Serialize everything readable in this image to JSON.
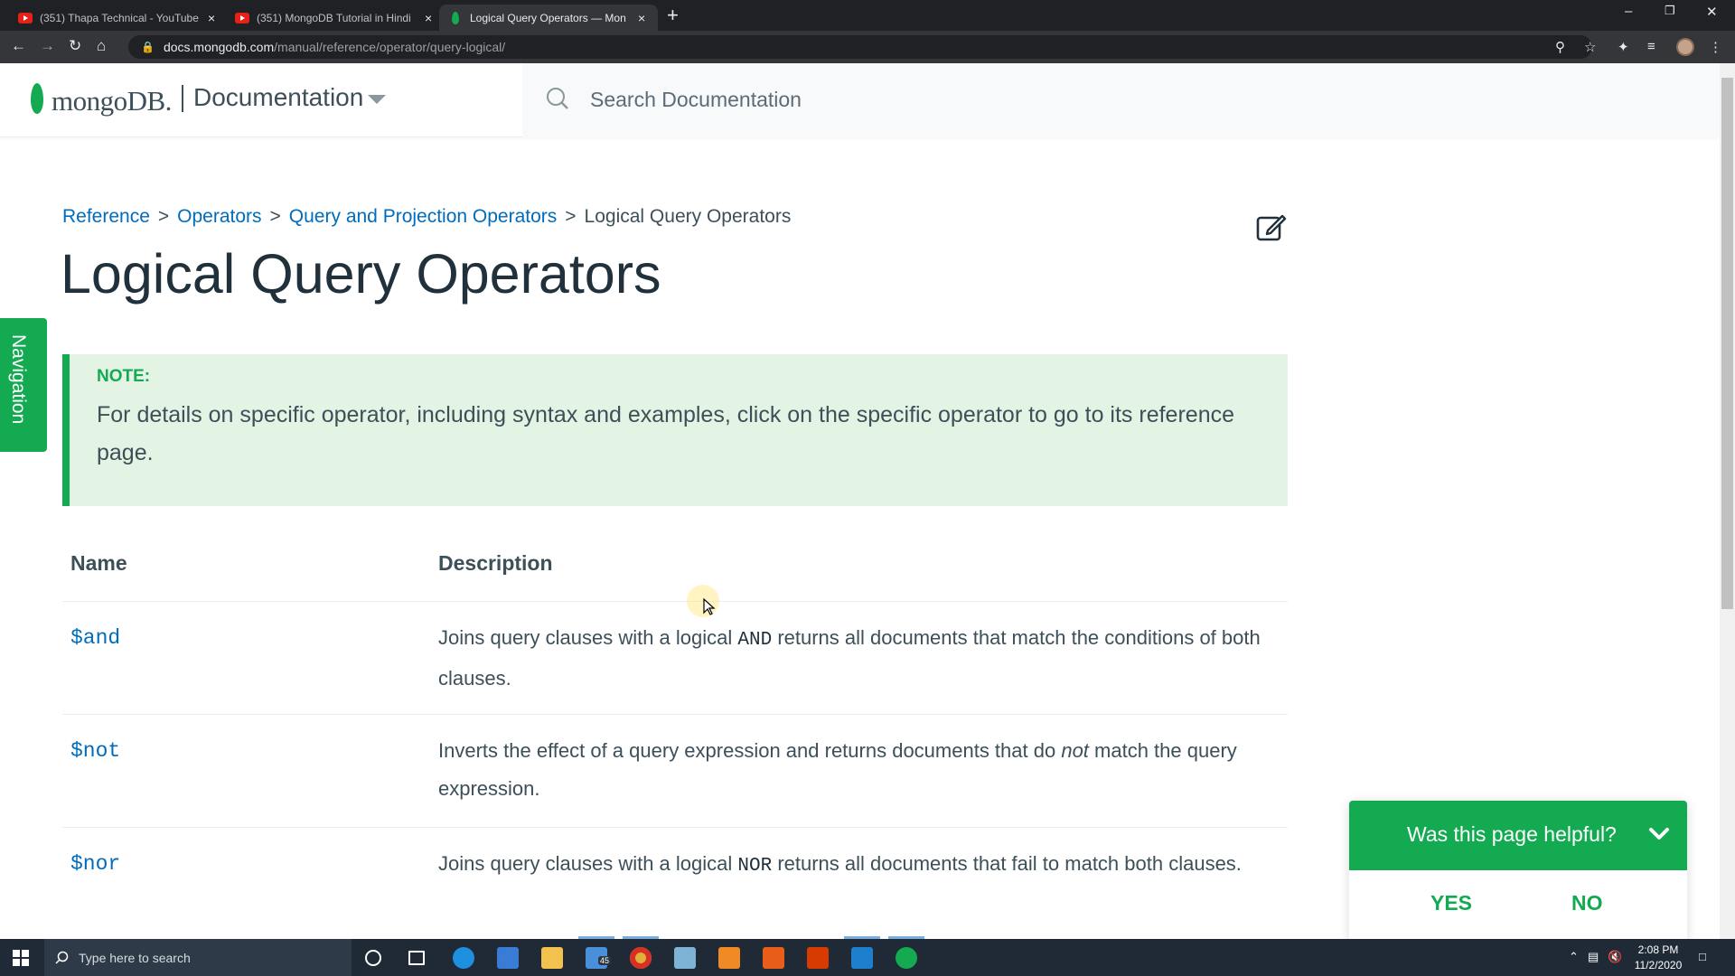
{
  "browser": {
    "tabs": [
      {
        "title": "(351) Thapa Technical - YouTube",
        "close": "×"
      },
      {
        "title": "(351) MongoDB Tutorial in Hindi",
        "close": "×"
      },
      {
        "title": "Logical Query Operators — Mon",
        "close": "×"
      }
    ],
    "new_tab": "+",
    "window_controls": {
      "minimize": "–",
      "restore": "❐",
      "close": "✕"
    },
    "url_host": "docs.mongodb.com",
    "url_path": "/manual/reference/operator/query-logical/"
  },
  "header": {
    "logo_text": "mongoDB.",
    "docs_title": "Documentation",
    "search_placeholder": "Search Documentation"
  },
  "nav_tab": "Navigation",
  "breadcrumb": {
    "items": [
      "Reference",
      "Operators",
      "Query and Projection Operators"
    ],
    "current": "Logical Query Operators",
    "separator": ">"
  },
  "page_title": "Logical Query Operators",
  "note": {
    "label": "NOTE:",
    "text": "For details on specific operator, including syntax and examples, click on the specific operator to go to its reference page."
  },
  "table": {
    "headers": [
      "Name",
      "Description"
    ],
    "rows": [
      {
        "name": "$and",
        "desc_pre": "Joins query clauses with a logical ",
        "desc_code": "AND",
        "desc_post": " returns all documents that match the conditions of both clauses."
      },
      {
        "name": "$not",
        "desc_pre": "Inverts the effect of a query expression and returns documents that do ",
        "desc_em": "not",
        "desc_post": " match the query expression."
      },
      {
        "name": "$nor",
        "desc_pre": "Joins query clauses with a logical ",
        "desc_code": "NOR",
        "desc_post": " returns all documents that fail to match both clauses."
      }
    ]
  },
  "feedback": {
    "question": "Was this page helpful?",
    "yes": "YES",
    "no": "NO"
  },
  "taskbar": {
    "search_placeholder": "Type here to search",
    "mail_badge": "45",
    "time": "2:08 PM",
    "date": "11/2/2020"
  },
  "colors": {
    "brand_green": "#13aa52",
    "link_blue": "#006cbc",
    "note_bg": "#e4f4e4",
    "text": "#3d4f58"
  }
}
